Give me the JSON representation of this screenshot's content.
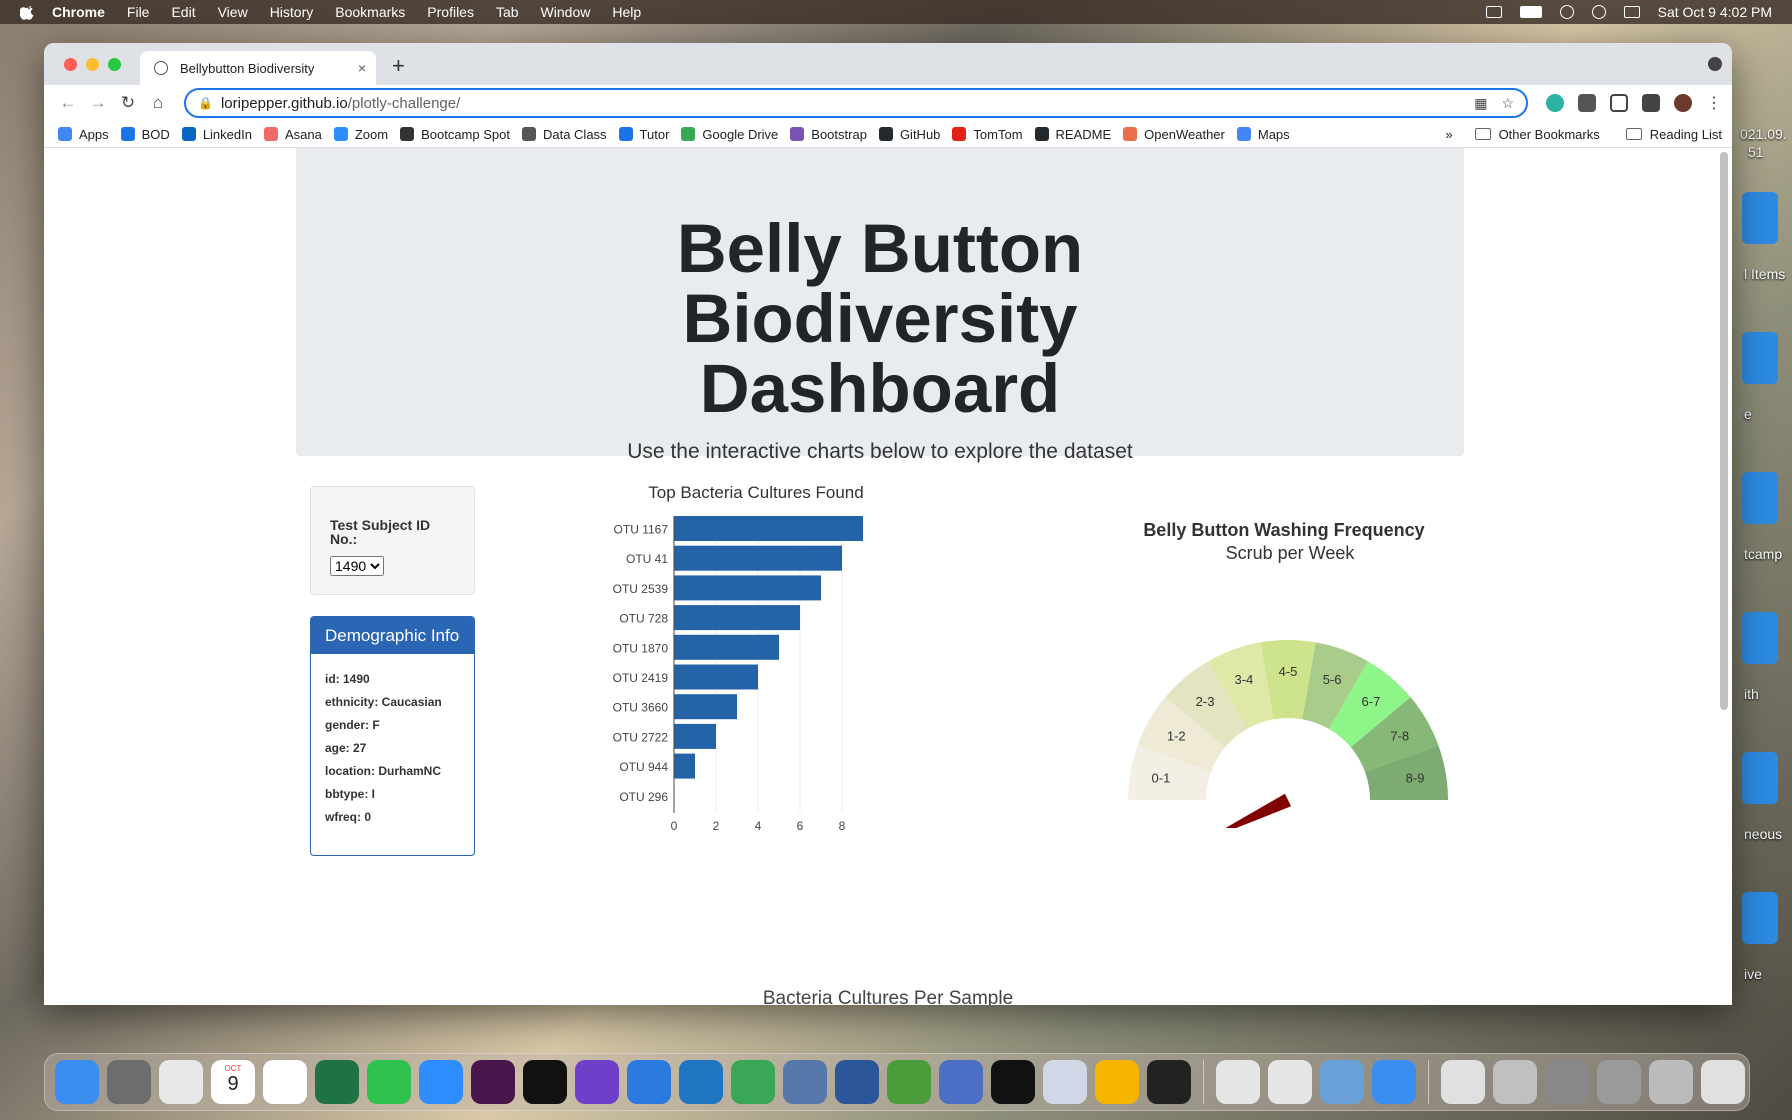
{
  "menubar": {
    "items": [
      "Chrome",
      "File",
      "Edit",
      "View",
      "History",
      "Bookmarks",
      "Profiles",
      "Tab",
      "Window",
      "Help"
    ],
    "clock": "Sat Oct 9  4:02 PM"
  },
  "desktop": {
    "labels": [
      "021.09.",
      "51",
      "l Items",
      "e",
      "tcamp",
      "ith",
      "neous",
      "ive"
    ]
  },
  "browser": {
    "tab_title": "Bellybutton Biodiversity",
    "tab_close": "×",
    "new_tab": "+",
    "url_host": "loripepper.github.io",
    "url_path": "/plotly-challenge/",
    "bookmarks": [
      {
        "label": "Apps",
        "color": "#4285f4"
      },
      {
        "label": "BOD",
        "color": "#1a73e8"
      },
      {
        "label": "LinkedIn",
        "color": "#0a66c2"
      },
      {
        "label": "Asana",
        "color": "#f06a6a"
      },
      {
        "label": "Zoom",
        "color": "#2d8cff"
      },
      {
        "label": "Bootcamp Spot",
        "color": "#333333"
      },
      {
        "label": "Data Class",
        "color": "#555555"
      },
      {
        "label": "Tutor",
        "color": "#1a73e8"
      },
      {
        "label": "Google Drive",
        "color": "#34a853"
      },
      {
        "label": "Bootstrap",
        "color": "#7952b3"
      },
      {
        "label": "GitHub",
        "color": "#24292e"
      },
      {
        "label": "TomTom",
        "color": "#e2231a"
      },
      {
        "label": "README",
        "color": "#24292e"
      },
      {
        "label": "OpenWeather",
        "color": "#eb6e4b"
      },
      {
        "label": "Maps",
        "color": "#4285f4"
      }
    ],
    "more": "»",
    "other_bookmarks": "Other Bookmarks",
    "reading_list": "Reading List"
  },
  "page": {
    "title": "Belly Button Biodiversity Dashboard",
    "subtitle": "Use the interactive charts below to explore the dataset",
    "selector_label": "Test Subject ID No.:",
    "selected_id": "1490",
    "demographic": {
      "heading": "Demographic Info",
      "rows": [
        "id: 1490",
        "ethnicity: Caucasian",
        "gender: F",
        "age: 27",
        "location: DurhamNC",
        "bbtype: I",
        "wfreq: 0"
      ]
    },
    "bottom_chart_title": "Bacteria Cultures Per Sample"
  },
  "chart_data": [
    {
      "type": "bar",
      "orientation": "horizontal",
      "title": "Top Bacteria Cultures Found",
      "categories": [
        "OTU 1167",
        "OTU 41",
        "OTU 2539",
        "OTU 728",
        "OTU 1870",
        "OTU 2419",
        "OTU 3660",
        "OTU 2722",
        "OTU 944",
        "OTU 296"
      ],
      "values": [
        9,
        8,
        7,
        6,
        5,
        4,
        3,
        2,
        1,
        0
      ],
      "xticks": [
        "0",
        "2",
        "4",
        "6",
        "8"
      ],
      "xlim": [
        0,
        9
      ],
      "color": "#2463a8",
      "grid": true
    },
    {
      "type": "gauge",
      "title": "Belly Button Washing Frequency",
      "subtitle": "Scrub per Week",
      "range": [
        0,
        9
      ],
      "value": 0,
      "segments": [
        {
          "label": "0-1",
          "color": "#f4efe5"
        },
        {
          "label": "1-2",
          "color": "#eeead6"
        },
        {
          "label": "2-3",
          "color": "#e4e3c2"
        },
        {
          "label": "3-4",
          "color": "#dfe8a6"
        },
        {
          "label": "4-5",
          "color": "#cde38c"
        },
        {
          "label": "5-6",
          "color": "#a9cc8a"
        },
        {
          "label": "6-7",
          "color": "#8ef588"
        },
        {
          "label": "7-8",
          "color": "#86b878"
        },
        {
          "label": "8-9",
          "color": "#7eab72"
        }
      ],
      "needle_color": "#800000"
    }
  ],
  "dock": {
    "colors": [
      "#3a8ef0",
      "#6d6d6d",
      "#e8e8e8",
      "#ffffff",
      "#ffffff",
      "#1f7244",
      "#2fc24f",
      "#2d8cff",
      "#4a154b",
      "#111111",
      "#6e40c9",
      "#2b7ae0",
      "#1f75c1",
      "#3aa757",
      "#5577aa",
      "#2b579a",
      "#4a9d3a",
      "#4a6fc4",
      "#111111",
      "#d0d7e6",
      "#f4b400",
      "#222222",
      "#e6e6e6",
      "#e6e6e6",
      "#6aa0d8",
      "#3a8ef0",
      "#e0e0e0",
      "#c0c0c0",
      "#888888",
      "#9a9a9a",
      "#bbbbbb",
      "#e0e0e0"
    ],
    "calendar_month": "OCT",
    "calendar_day": "9"
  }
}
